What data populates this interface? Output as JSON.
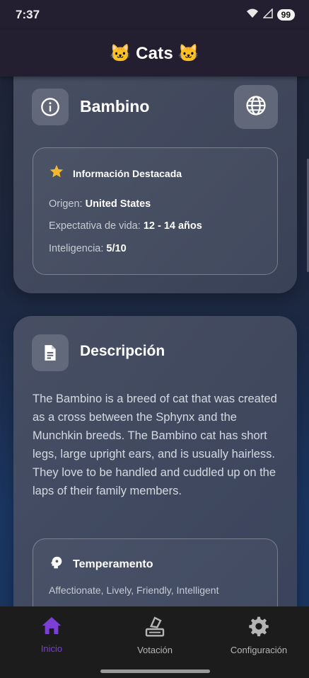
{
  "status_bar": {
    "time": "7:37",
    "battery": "99"
  },
  "app_bar": {
    "title": "🐱 Cats 🐱"
  },
  "breed_card": {
    "name": "Bambino",
    "highlight": {
      "title": "Información Destacada",
      "origin_label": "Origen:",
      "origin_value": "United States",
      "life_label": "Expectativa de vida:",
      "life_value": "12 - 14 años",
      "intel_label": "Inteligencia:",
      "intel_value": "5/10"
    }
  },
  "description_card": {
    "title": "Descripción",
    "text": "The Bambino is a breed of cat that was created as a cross between the Sphynx and the Munchkin breeds. The Bambino cat has short legs, large upright ears, and is usually hairless. They love to be handled and cuddled up on the laps of their family members.",
    "temperament": {
      "title": "Temperamento",
      "value": "Affectionate, Lively, Friendly, Intelligent"
    }
  },
  "bottom_nav": {
    "items": [
      {
        "label": "Inicio",
        "icon": "home-icon",
        "active": true
      },
      {
        "label": "Votación",
        "icon": "vote-icon",
        "active": false
      },
      {
        "label": "Configuración",
        "icon": "gear-icon",
        "active": false
      }
    ]
  },
  "colors": {
    "accent": "#7b3fd6",
    "star": "#f5b82e",
    "bar": "#241f30"
  }
}
